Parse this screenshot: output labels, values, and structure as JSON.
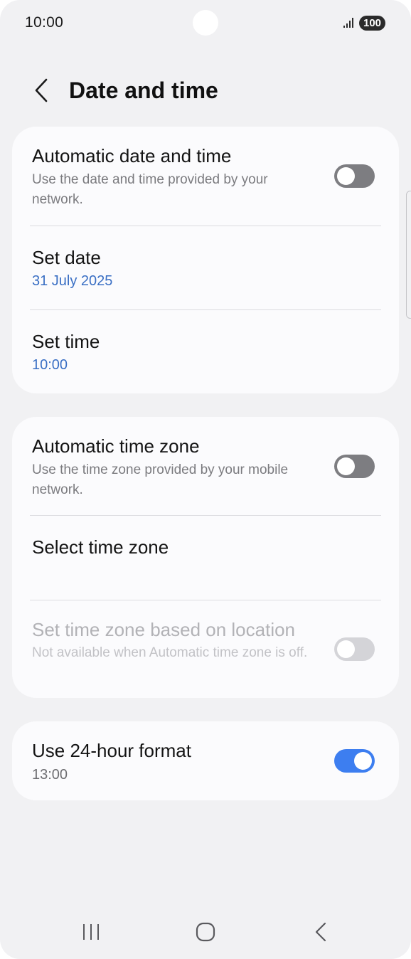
{
  "status_bar": {
    "time": "10:00",
    "battery": "100"
  },
  "header": {
    "title": "Date and time"
  },
  "group1": {
    "auto_date_time": {
      "title": "Automatic date and time",
      "subtitle": "Use the date and time provided by your network.",
      "toggle": "off"
    },
    "set_date": {
      "title": "Set date",
      "value": "31 July 2025"
    },
    "set_time": {
      "title": "Set time",
      "value": "10:00"
    }
  },
  "group2": {
    "auto_time_zone": {
      "title": "Automatic time zone",
      "subtitle": "Use the time zone provided by your mobile network.",
      "toggle": "off"
    },
    "select_time_zone": {
      "title": "Select time zone"
    },
    "location_time_zone": {
      "title": "Set time zone based on location",
      "subtitle": "Not available when Automatic time zone is off.",
      "toggle": "off",
      "disabled": true
    }
  },
  "group3": {
    "use_24_hour": {
      "title": "Use 24-hour format",
      "value": "13:00",
      "toggle": "on"
    }
  },
  "colors": {
    "background": "#f1f1f3",
    "card": "#fbfbfd",
    "accent": "#3d7ef0",
    "value_link": "#3a6fc4",
    "toggle_off": "#7d7d81"
  },
  "icons": {
    "back": "chevron-left-icon",
    "signal": "signal-bars-icon",
    "nav_recents": "recents-icon",
    "nav_home": "home-icon",
    "nav_back": "back-icon"
  }
}
